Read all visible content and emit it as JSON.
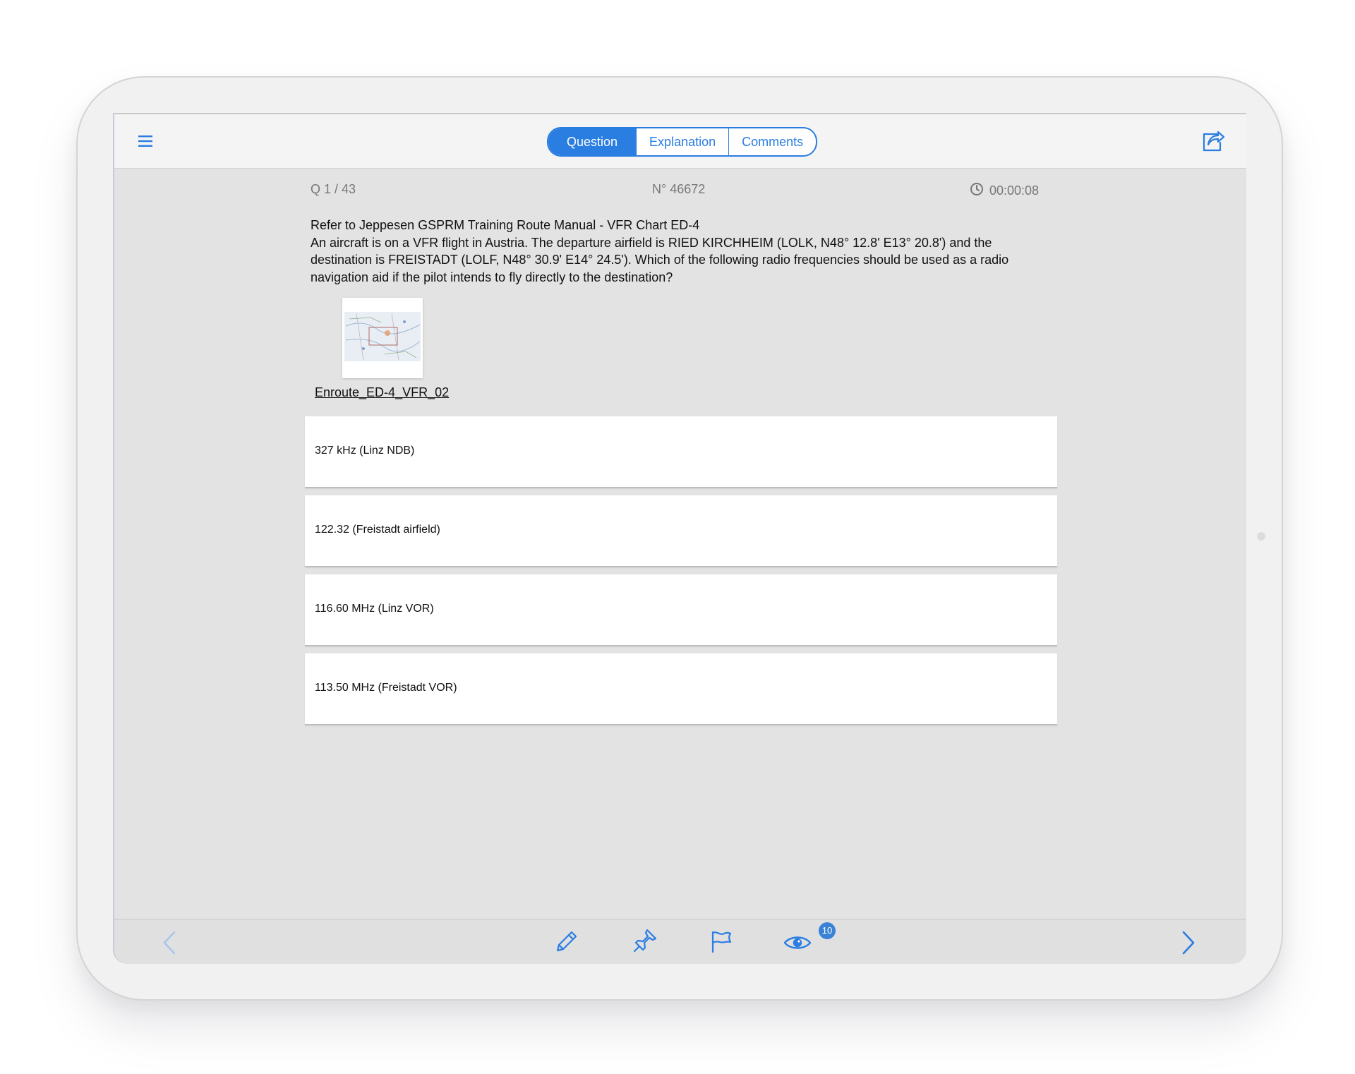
{
  "tabs": [
    {
      "label": "Question",
      "active": true
    },
    {
      "label": "Explanation",
      "active": false
    },
    {
      "label": "Comments",
      "active": false
    }
  ],
  "meta": {
    "question_counter": "Q  1 / 43",
    "question_number": "N° 46672",
    "timer": "00:00:08"
  },
  "question": {
    "lines": [
      "Refer to Jeppesen GSPRM Training Route Manual - VFR Chart ED-4",
      "An aircraft is on a VFR flight in Austria. The departure airfield is RIED KIRCHHEIM (LOLK, N48° 12.8' E13° 20.8') and the",
      "destination is FREISTADT (LOLF, N48° 30.9' E14° 24.5'). Which of the following radio frequencies should be used as a radio",
      "navigation aid if the pilot intends to fly directly to the destination?"
    ]
  },
  "attachment": {
    "caption": "Enroute_ED-4_VFR_02"
  },
  "answers": [
    "327 kHz (Linz NDB)",
    "122.32 (Freistadt airfield)",
    "116.60 MHz (Linz VOR)",
    "113.50 MHz (Freistadt VOR)"
  ],
  "toolbar": {
    "views_badge": "10"
  },
  "colors": {
    "accent": "#2a7de1",
    "screen_bg": "#e3e3e4",
    "answer_bg": "#ffffff"
  },
  "icons": [
    "menu-icon",
    "share-icon",
    "clock-icon",
    "prev-chevron-icon",
    "pencil-icon",
    "pin-icon",
    "flag-icon",
    "eye-icon",
    "next-chevron-icon"
  ]
}
